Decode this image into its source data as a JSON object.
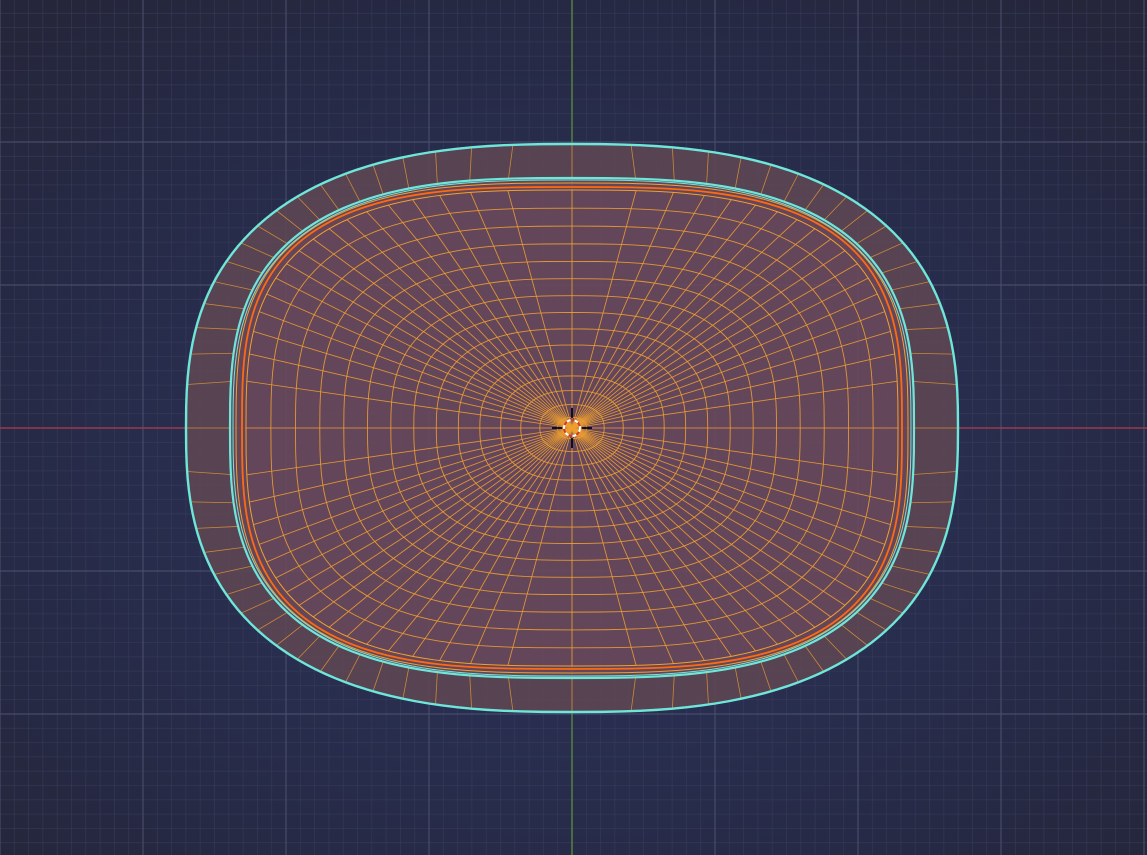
{
  "viewport": {
    "background_top": "#25263a",
    "background_center": "#2e3560",
    "background_bottom": "#262a46"
  },
  "grid": {
    "minor_color": "#3a3f5e",
    "major_color": "#4a4f6c"
  },
  "axes": {
    "x_axis_color": "#a83a4c",
    "y_axis_color": "#5c8a3a"
  },
  "mesh": {
    "selected_wire_color": "#f0a030",
    "active_edge_color": "#ff6a10",
    "boundary_edge_color": "#6ee6da",
    "face_fill_color": "#6e4a5c",
    "rim_fill_color": "#5c4552",
    "radial_segments": 72,
    "ring_count": 14
  },
  "cursor_3d": {
    "icon": "3d-cursor-icon",
    "color_primary": "#000000",
    "color_secondary": "#ffffff"
  }
}
